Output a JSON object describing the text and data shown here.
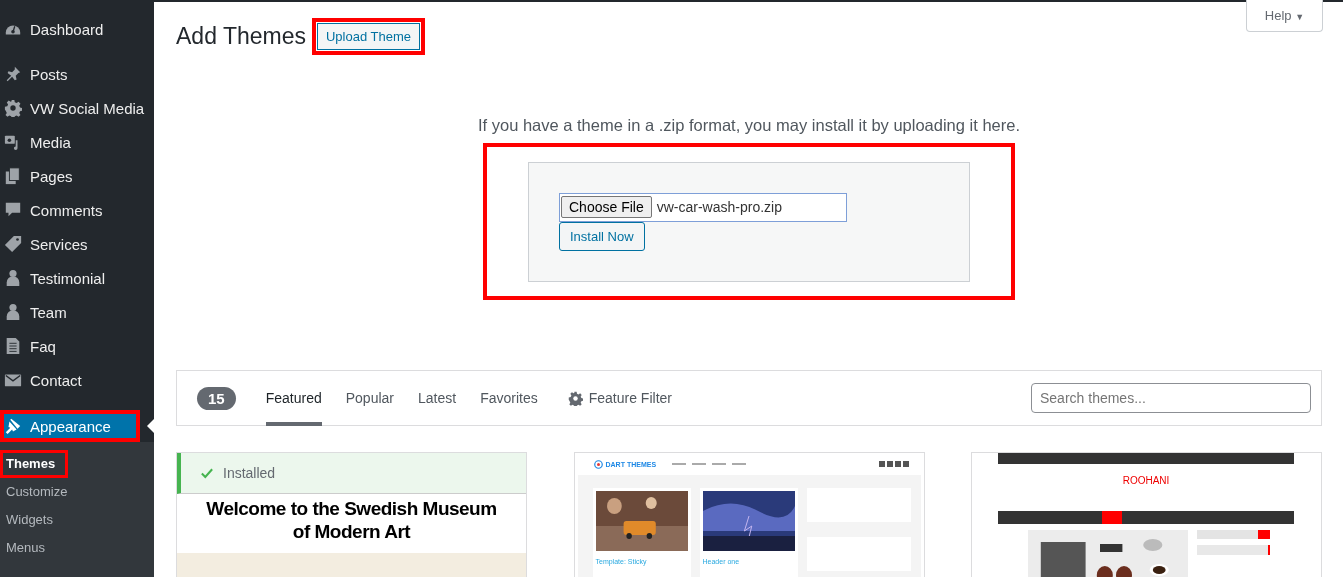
{
  "sidebar": {
    "items": [
      {
        "label": "Dashboard",
        "kind": "gauge",
        "selected": false,
        "highlighted": false
      },
      {
        "label": "Posts",
        "kind": "pin",
        "selected": false,
        "highlighted": false
      },
      {
        "label": "VW Social Media",
        "kind": "gear",
        "selected": false,
        "highlighted": false
      },
      {
        "label": "Media",
        "kind": "media",
        "selected": false,
        "highlighted": false
      },
      {
        "label": "Pages",
        "kind": "pages",
        "selected": false,
        "highlighted": false
      },
      {
        "label": "Comments",
        "kind": "comment",
        "selected": false,
        "highlighted": false
      },
      {
        "label": "Services",
        "kind": "tag",
        "selected": false,
        "highlighted": false
      },
      {
        "label": "Testimonial",
        "kind": "person",
        "selected": false,
        "highlighted": false
      },
      {
        "label": "Team",
        "kind": "person",
        "selected": false,
        "highlighted": false
      },
      {
        "label": "Faq",
        "kind": "doc",
        "selected": false,
        "highlighted": false
      },
      {
        "label": "Contact",
        "kind": "envelope",
        "selected": false,
        "highlighted": false
      },
      {
        "label": "Appearance",
        "kind": "brush",
        "selected": true,
        "highlighted": true
      }
    ],
    "submenu": [
      {
        "label": "Themes",
        "selected": true,
        "highlighted": true
      },
      {
        "label": "Customize",
        "selected": false,
        "highlighted": false
      },
      {
        "label": "Widgets",
        "selected": false,
        "highlighted": false
      },
      {
        "label": "Menus",
        "selected": false,
        "highlighted": false
      }
    ]
  },
  "help": {
    "label": "Help",
    "caret": "▼"
  },
  "header": {
    "title": "Add Themes",
    "upload_button": {
      "label": "Upload Theme",
      "highlighted": true
    }
  },
  "upload": {
    "description": "If you have a theme in a .zip format, you may install it by uploading it here.",
    "highlighted": true,
    "choose_label": "Choose File",
    "file_name": "vw-car-wash-pro.zip",
    "install_label": "Install Now"
  },
  "filter": {
    "count": "15",
    "tabs": [
      {
        "label": "Featured",
        "selected": true
      },
      {
        "label": "Popular",
        "selected": false
      },
      {
        "label": "Latest",
        "selected": false
      },
      {
        "label": "Favorites",
        "selected": false
      }
    ],
    "feature_filter": "Feature Filter",
    "search_placeholder": "Search themes..."
  },
  "themes": [
    {
      "kind": "museum",
      "installed": true,
      "installed_label": "Installed",
      "headline": "Welcome to the Swedish Museum of Modern Art"
    },
    {
      "kind": "dart",
      "logo": "DART THEMES",
      "post_titles": [
        "Template: Sticky",
        "Header one"
      ]
    },
    {
      "kind": "roohani",
      "logo": "ROOHANI"
    }
  ]
}
